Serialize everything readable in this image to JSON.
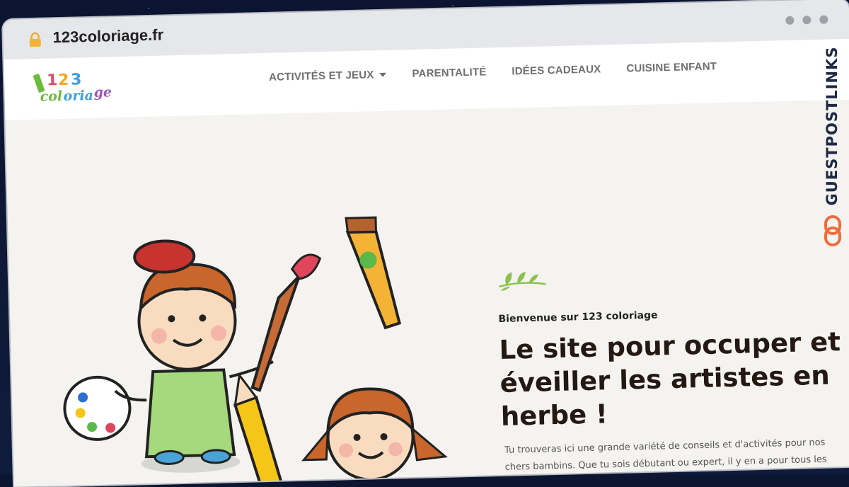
{
  "browser": {
    "url": "123coloriage.fr"
  },
  "site": {
    "logo_text": "123 coloriage",
    "nav": [
      {
        "label": "ACTIVITÉS ET JEUX",
        "has_dropdown": true
      },
      {
        "label": "PARENTALITÉ",
        "has_dropdown": false
      },
      {
        "label": "IDÉES CADEAUX",
        "has_dropdown": false
      },
      {
        "label": "CUISINE ENFANT",
        "has_dropdown": false
      }
    ]
  },
  "hero": {
    "welcome": "Bienvenue sur 123 coloriage",
    "headline": "Le site pour occuper et éveiller les artistes en herbe !",
    "intro": "Tu trouveras ici une grande variété de conseils et d'activités pour nos chers bambins. Que tu sois débutant ou expert, il y en a pour tous les"
  },
  "watermark": {
    "text": "GUESTPOSTLINKS"
  },
  "colors": {
    "nav_text": "#6f6f6f",
    "headline": "#241812",
    "accent_leaf": "#8cc152",
    "watermark_icon": "#f26b3a"
  }
}
